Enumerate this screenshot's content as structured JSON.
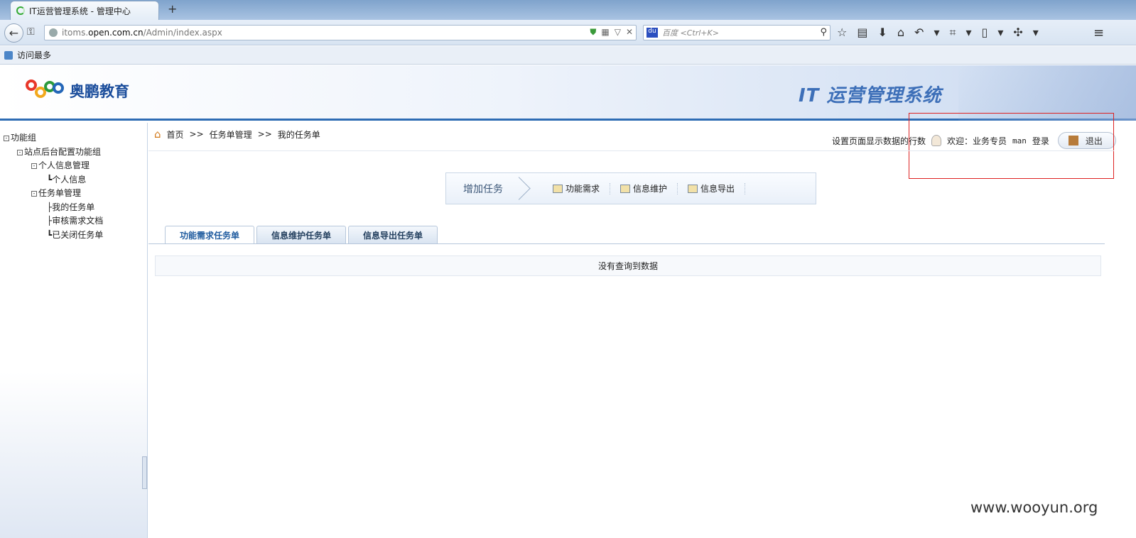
{
  "browser": {
    "tab_title": "IT运营管理系统 - 管理中心",
    "new_tab_symbol": "+",
    "url_prefix": "itoms.",
    "url_domain": "open.com.cn",
    "url_path": "/Admin/index.aspx",
    "search_placeholder": "百度 <Ctrl+K>",
    "bookmark_label": "访问最多"
  },
  "header": {
    "logo_text": "奥鹏教育",
    "system_title": "IT 运营管理系统"
  },
  "tree": {
    "root": "功能组",
    "group": "站点后台配置功能组",
    "personal": "个人信息管理",
    "personal_info": "个人信息",
    "tasks": "任务单管理",
    "my_tasks": "我的任务单",
    "review_docs": "审核需求文档",
    "closed_tasks": "已关闭任务单"
  },
  "breadcrumb": {
    "home": "首页",
    "sep1": ">>",
    "level2": "任务单管理",
    "sep2": ">>",
    "current": "我的任务单"
  },
  "topbar": {
    "rows_setting": "设置页面显示数据的行数",
    "welcome": "欢迎：业务专员",
    "username": "man",
    "login_suffix": "登录",
    "logout": "退出"
  },
  "actions": {
    "add_task": "增加任务",
    "func_req": "功能需求",
    "info_maint": "信息维护",
    "info_export": "信息导出"
  },
  "tabs": [
    {
      "label": "功能需求任务单"
    },
    {
      "label": "信息维护任务单"
    },
    {
      "label": "信息导出任务单"
    }
  ],
  "table": {
    "empty_message": "没有查询到数据"
  },
  "watermark": "www.wooyun.org",
  "colors": {
    "accent": "#2e6cb4",
    "highlight_box": "#dd2222"
  }
}
